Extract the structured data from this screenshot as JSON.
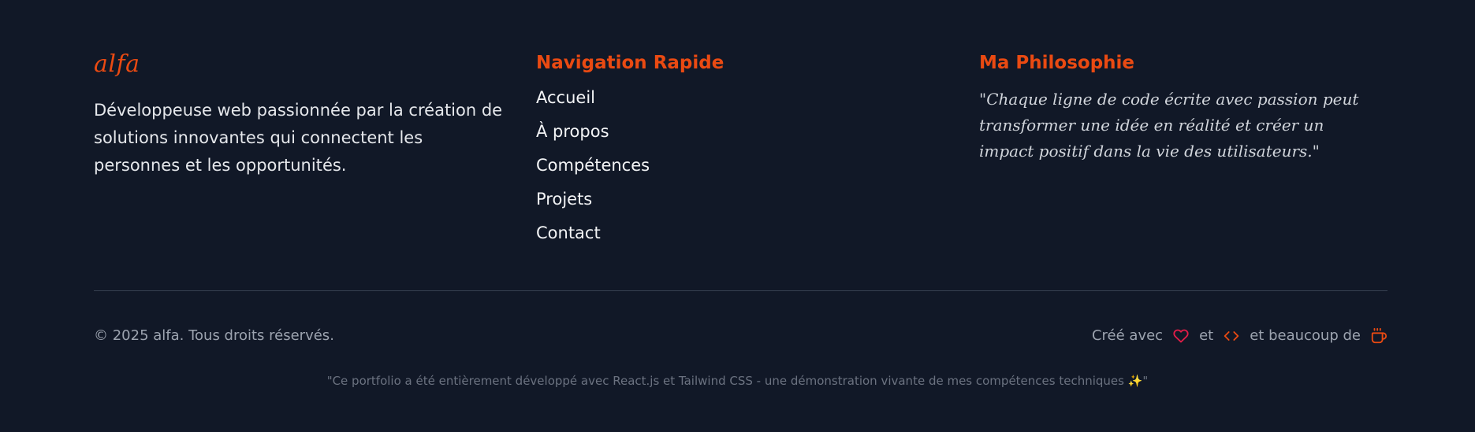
{
  "brand": {
    "logo": "alfa",
    "description": "Développeuse web passionnée par la création de solutions innovantes qui connectent les personnes et les opportunités."
  },
  "navigation": {
    "heading": "Navigation Rapide",
    "items": [
      {
        "label": "Accueil"
      },
      {
        "label": "À propos"
      },
      {
        "label": "Compétences"
      },
      {
        "label": "Projets"
      },
      {
        "label": "Contact"
      }
    ]
  },
  "philosophy": {
    "heading": "Ma Philosophie",
    "quote": "\"Chaque ligne de code écrite avec passion peut transformer une idée en réalité et créer un impact positif dans la vie des utilisateurs.\""
  },
  "bottom": {
    "copyright": "© 2025 alfa. Tous droits réservés.",
    "made_with_prefix": "Créé avec",
    "made_with_and": "et",
    "made_with_suffix": "et beaucoup de",
    "icons": [
      "heart-icon",
      "code-icon",
      "coffee-icon"
    ],
    "tagline": "\"Ce portfolio a été entièrement développé avec React.js et Tailwind CSS - une démonstration vivante de mes compétences techniques ✨\""
  },
  "colors": {
    "background": "#111827",
    "accent": "#ea4a12",
    "heart": "#e11d48",
    "text": "#e5e7eb",
    "muted": "#9ca3af",
    "divider": "#374151"
  }
}
